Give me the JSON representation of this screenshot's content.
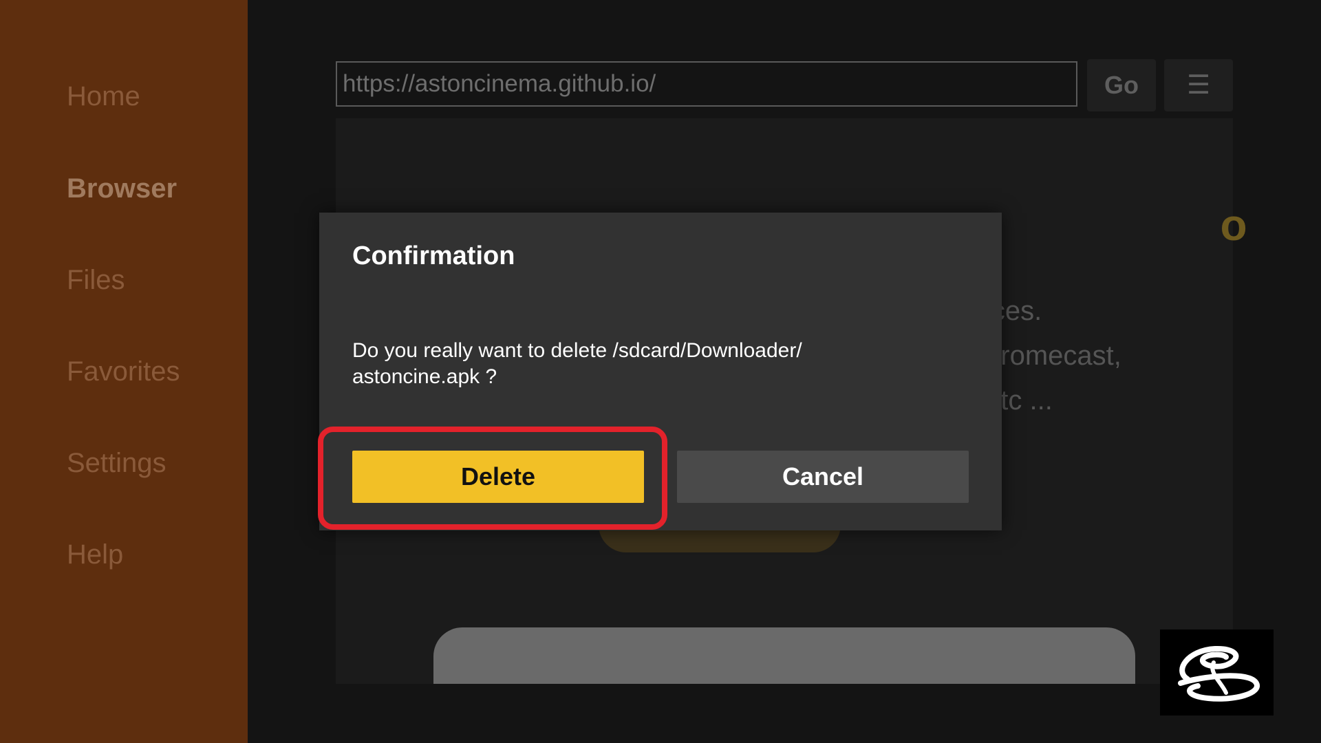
{
  "sidebar": {
    "items": [
      {
        "label": "Home"
      },
      {
        "label": "Browser"
      },
      {
        "label": "Files"
      },
      {
        "label": "Favorites"
      },
      {
        "label": "Settings"
      },
      {
        "label": "Help"
      }
    ]
  },
  "browser": {
    "url": "https://astoncinema.github.io/",
    "go_label": "Go",
    "menu_icon": "menu-icon",
    "menu_glyph": "☰"
  },
  "webpage": {
    "lines": [
      "ices.",
      "nromecast,",
      "etc ..."
    ]
  },
  "dialog": {
    "title": "Confirmation",
    "message": "Do you really want to delete /sdcard/Downloader/\nastoncine.apk ?",
    "delete_label": "Delete",
    "cancel_label": "Cancel"
  },
  "colors": {
    "sidebar": "#5e2e0e",
    "accent": "#f2c026",
    "highlight": "#e3222b"
  }
}
